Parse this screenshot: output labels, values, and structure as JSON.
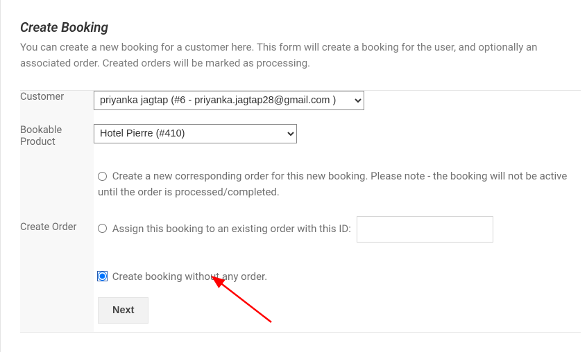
{
  "title": "Create Booking",
  "description": "You can create a new booking for a customer here. This form will create a booking for the user, and optionally an associated order. Created orders will be marked as processing.",
  "labels": {
    "customer": "Customer",
    "bookable_product_line1": "Bookable",
    "bookable_product_line2": "Product",
    "create_order": "Create Order"
  },
  "customer_select": {
    "selected": "priyanka jagtap (#6 - priyanka.jagtap28@gmail.com )"
  },
  "product_select": {
    "selected": "Hotel Pierre (#410)"
  },
  "order_options": {
    "new_order": "Create a new corresponding order for this new booking. Please note - the booking will not be active until the order is processed/completed.",
    "assign_existing": "Assign this booking to an existing order with this ID:",
    "no_order": "Create booking without any order."
  },
  "buttons": {
    "next": "Next"
  }
}
